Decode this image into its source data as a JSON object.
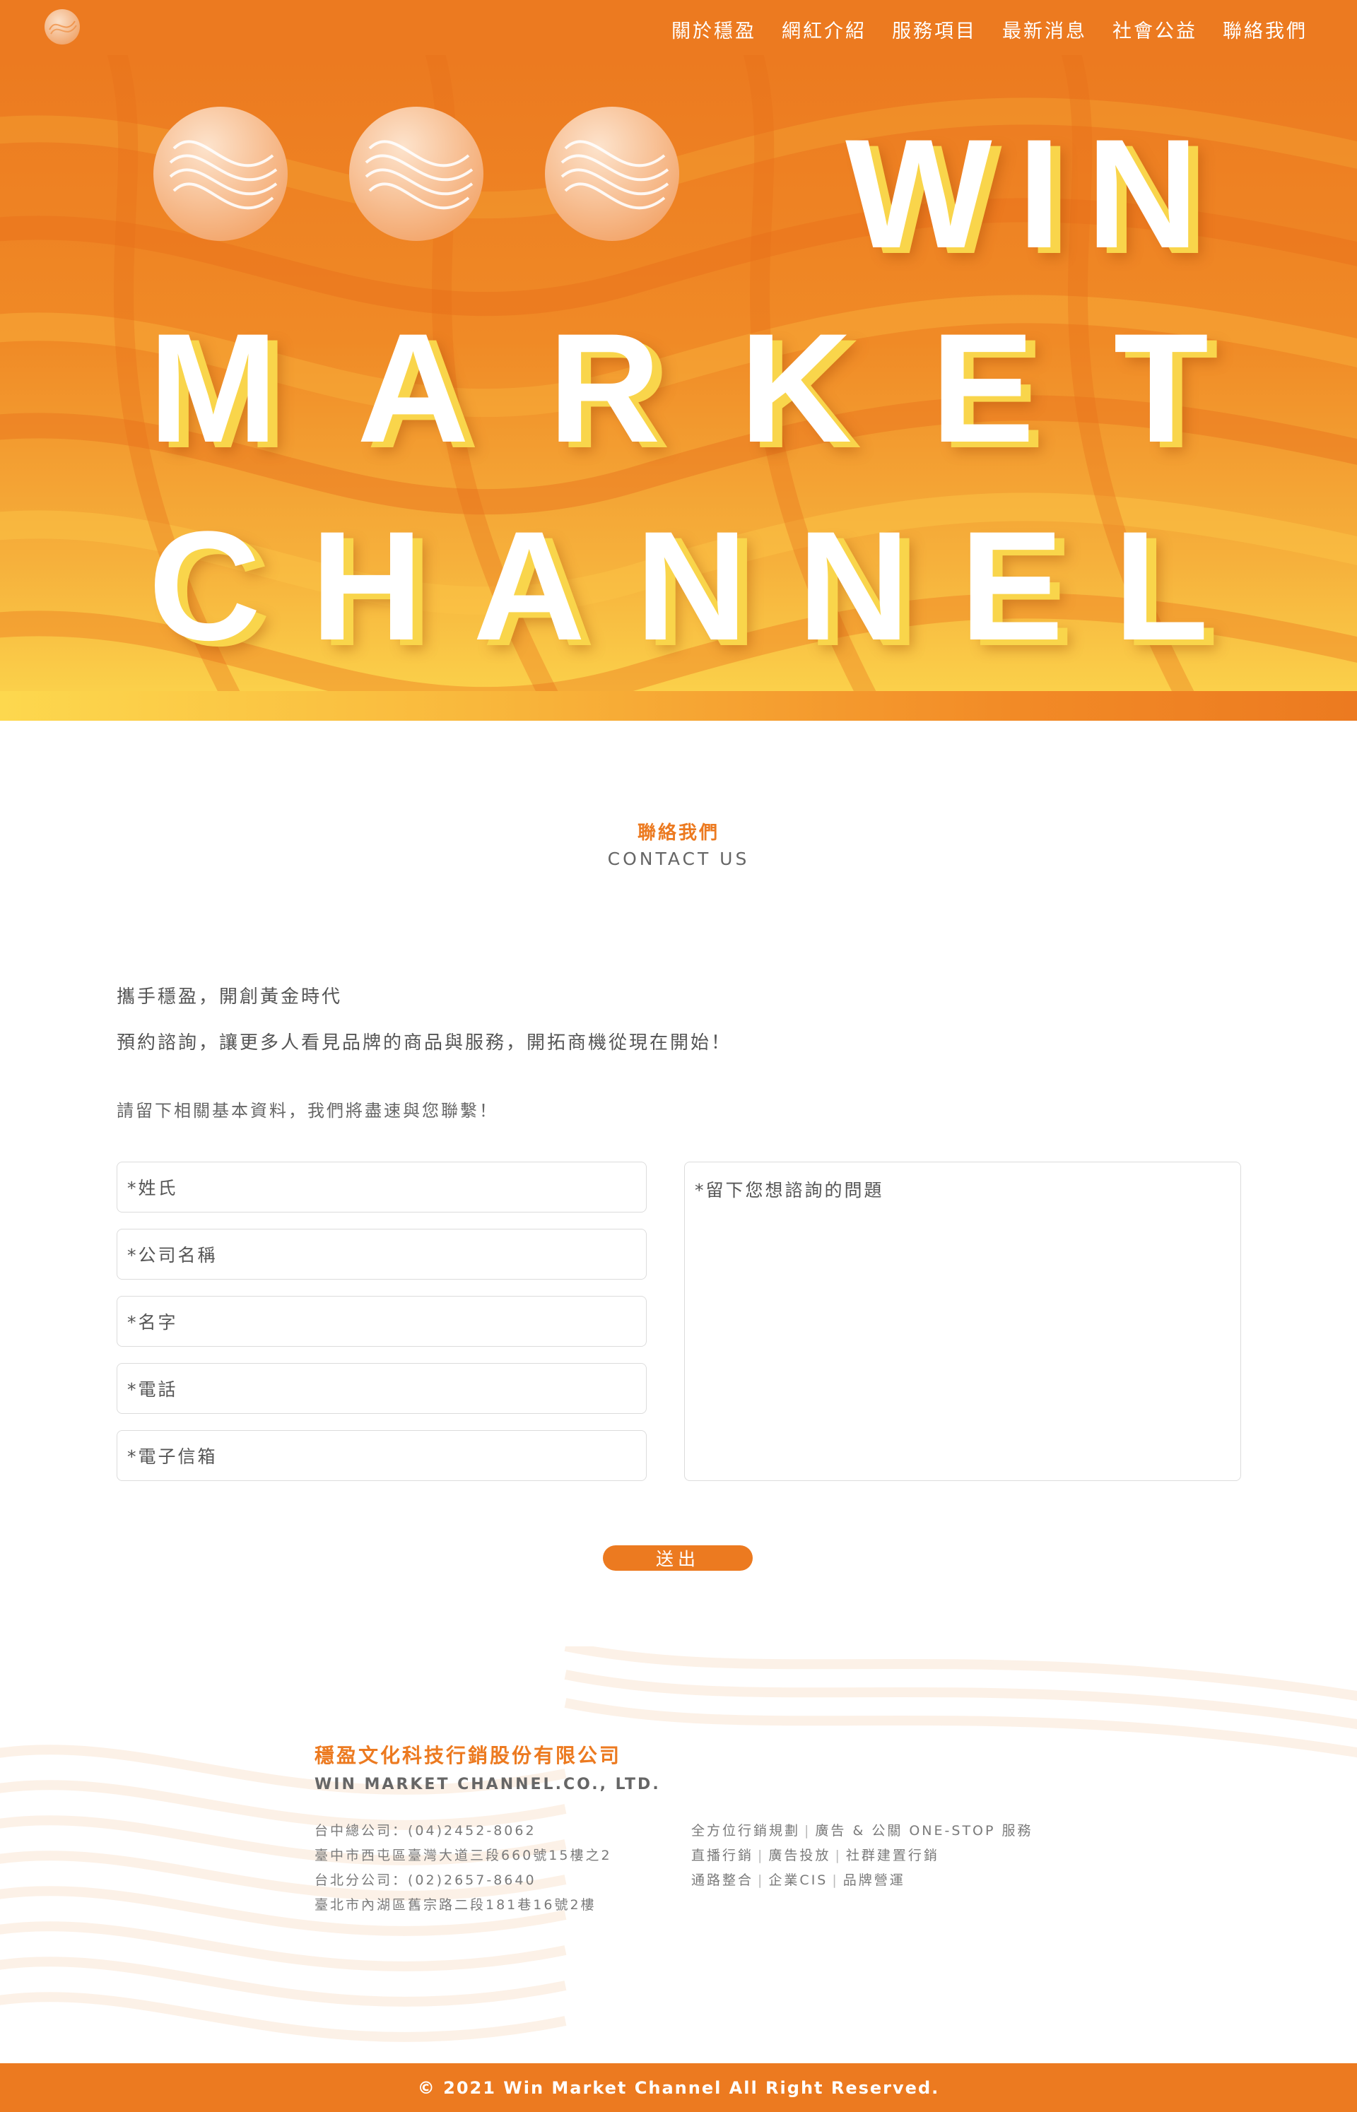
{
  "nav": {
    "items": [
      "關於穩盈",
      "網紅介紹",
      "服務項目",
      "最新消息",
      "社會公益",
      "聯絡我們"
    ]
  },
  "hero": {
    "line1": [
      "W",
      "I",
      "N"
    ],
    "line2": [
      "M",
      "A",
      "R",
      "K",
      "E",
      "T"
    ],
    "line3": [
      "C",
      "H",
      "A",
      "N",
      "N",
      "E",
      "L"
    ]
  },
  "contact": {
    "title_zh": "聯絡我們",
    "title_en": "CONTACT US",
    "intro1": "攜手穩盈，開創黃金時代",
    "intro2": "預約諮詢，讓更多人看見品牌的商品與服務，開拓商機從現在開始！",
    "intro3": "請留下相關基本資料，我們將盡速與您聯繫！",
    "fields": [
      "*姓氏",
      "*公司名稱",
      "*名字",
      "*電話",
      "*電子信箱"
    ],
    "message_placeholder": "*留下您想諮詢的問題",
    "submit_label": "送出"
  },
  "footer": {
    "company_zh": "穩盈文化科技行銷股份有限公司",
    "company_en": "WIN MARKET CHANNEL.CO., LTD.",
    "address_lines": [
      "台中總公司：(04)2452-8062",
      "臺中市西屯區臺灣大道三段660號15樓之2",
      "台北分公司：(02)2657-8640",
      "臺北市內湖區舊宗路二段181巷16號2樓"
    ],
    "services": [
      [
        "全方位行銷規劃",
        "廣告 & 公關 ONE-STOP 服務"
      ],
      [
        "直播行銷",
        "廣告投放",
        "社群建置行銷"
      ],
      [
        "通路整合",
        "企業CIS",
        "品牌營運"
      ]
    ],
    "copyright": "© 2021 Win Market Channel All Right Reserved."
  },
  "colors": {
    "brand_orange": "#ec7a20",
    "brand_yellow": "#fbd04a"
  },
  "icons": {
    "logo": "wave-sphere-icon"
  }
}
